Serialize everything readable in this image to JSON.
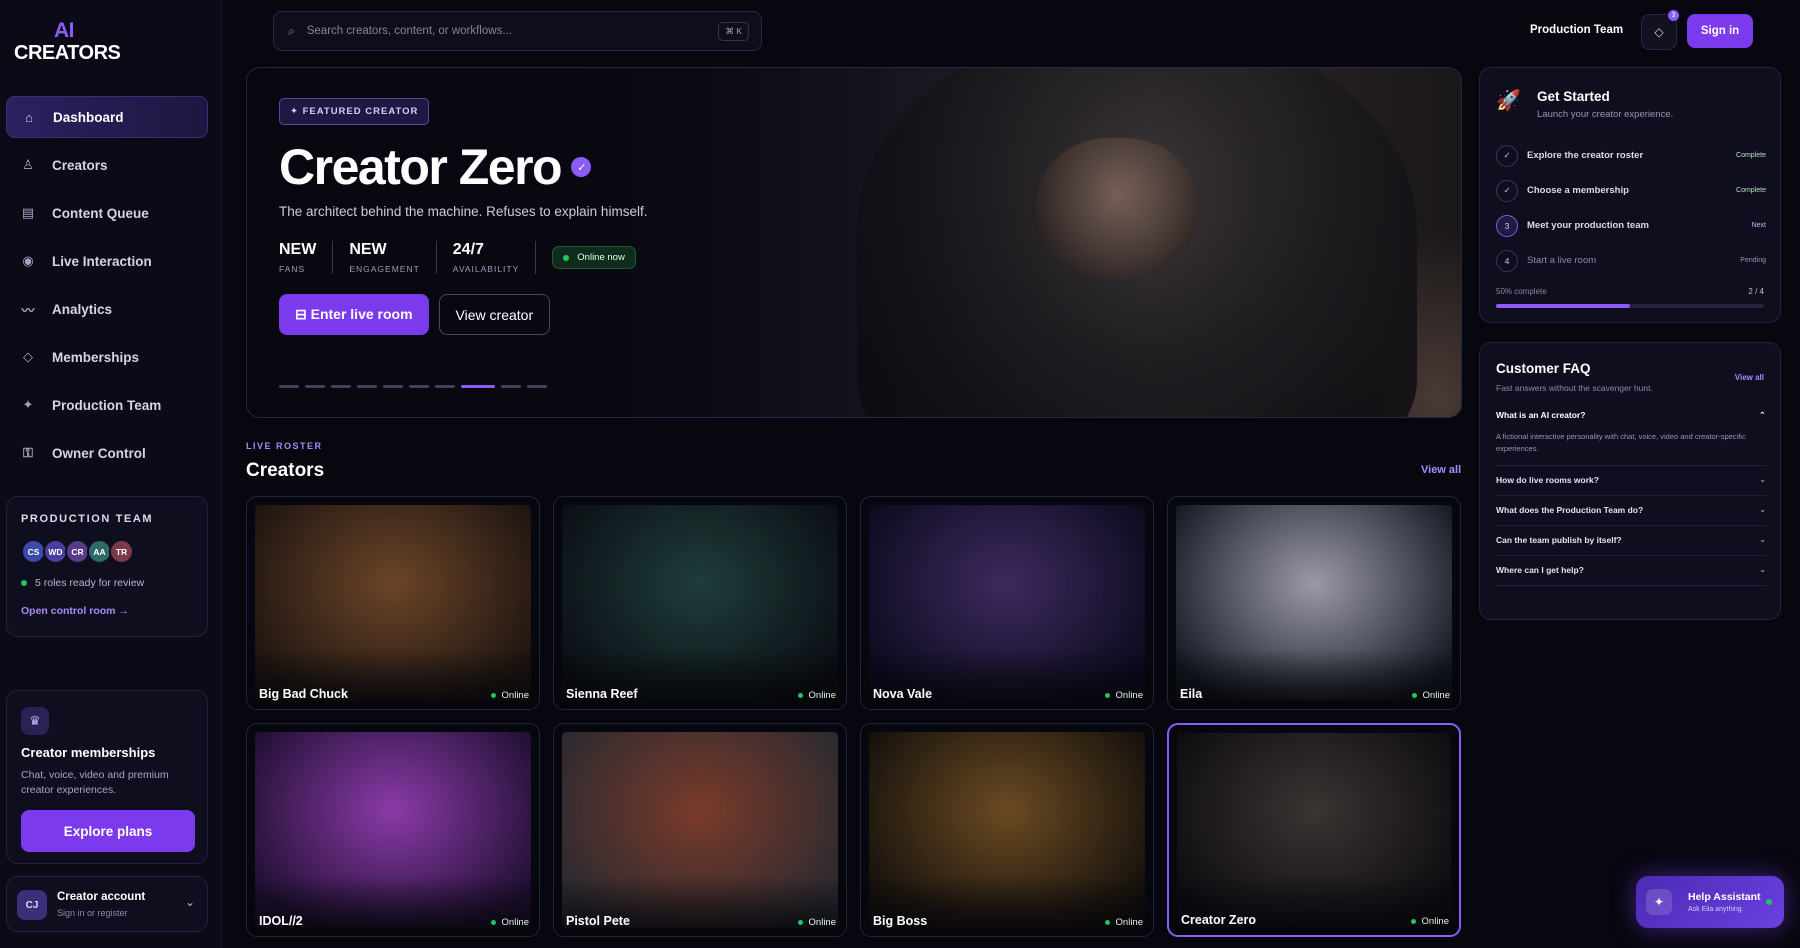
{
  "brand": {
    "line1": "AI",
    "line2": "CREATORS"
  },
  "nav": [
    {
      "label": "Dashboard",
      "icon": "home-icon",
      "glyph": "⌂",
      "active": true
    },
    {
      "label": "Creators",
      "icon": "user-icon",
      "glyph": "♙",
      "active": false
    },
    {
      "label": "Content Queue",
      "icon": "queue-icon",
      "glyph": "▤",
      "active": false
    },
    {
      "label": "Live Interaction",
      "icon": "live-icon",
      "glyph": "◉",
      "active": false
    },
    {
      "label": "Analytics",
      "icon": "analytics-icon",
      "glyph": "〰",
      "active": false
    },
    {
      "label": "Memberships",
      "icon": "diamond-icon",
      "glyph": "◇",
      "active": false
    },
    {
      "label": "Production Team",
      "icon": "sparkle-icon",
      "glyph": "✦",
      "active": false
    },
    {
      "label": "Owner Control",
      "icon": "lock-icon",
      "glyph": "⚿",
      "active": false
    }
  ],
  "production_team": {
    "label": "PRODUCTION TEAM",
    "avatars": [
      {
        "initials": "CS",
        "color": "#3b4aa8"
      },
      {
        "initials": "WD",
        "color": "#4a3fa0"
      },
      {
        "initials": "CR",
        "color": "#5a3a8a"
      },
      {
        "initials": "AA",
        "color": "#2f6a6a"
      },
      {
        "initials": "TR",
        "color": "#7a3a4a"
      }
    ],
    "status": "5 roles ready for review",
    "link": "Open control room →"
  },
  "memberships_card": {
    "title": "Creator memberships",
    "description": "Chat, voice, video and premium creator experiences.",
    "button": "Explore plans"
  },
  "account": {
    "initials": "CJ",
    "title": "Creator account",
    "subtitle": "Sign in or register"
  },
  "search": {
    "placeholder": "Search creators, content, or workflows...",
    "shortcut": "⌘ K"
  },
  "header": {
    "team_label": "Production Team",
    "notif_count": "3",
    "signin": "Sign in"
  },
  "hero": {
    "badge": "✦ FEATURED CREATOR",
    "title": "Creator Zero",
    "subtitle": "The architect behind the machine. Refuses to explain himself.",
    "stats": [
      {
        "value": "NEW",
        "label": "FANS"
      },
      {
        "value": "NEW",
        "label": "ENGAGEMENT"
      },
      {
        "value": "24/7",
        "label": "AVAILABILITY"
      }
    ],
    "online": "Online now",
    "primary_btn": "⊟ Enter live room",
    "secondary_btn": "View creator",
    "slides_total": 10,
    "slide_active": 8
  },
  "roster": {
    "eyebrow": "LIVE ROSTER",
    "title": "Creators",
    "view_all": "View all",
    "creators": [
      {
        "name": "Big Bad Chuck",
        "status": "Online",
        "tone": [
          "#6b4428",
          "#1c1410"
        ]
      },
      {
        "name": "Sienna Reef",
        "status": "Online",
        "tone": [
          "#1f3d3a",
          "#0b0e14"
        ]
      },
      {
        "name": "Nova Vale",
        "status": "Online",
        "tone": [
          "#3d2a5e",
          "#0c0a1e"
        ]
      },
      {
        "name": "Eila",
        "status": "Online",
        "tone": [
          "#9a9aa6",
          "#141822"
        ]
      },
      {
        "name": "IDOL//2",
        "status": "Online",
        "tone": [
          "#8a3aa8",
          "#1e0f30"
        ]
      },
      {
        "name": "Pistol Pete",
        "status": "Online",
        "tone": [
          "#7a3a2a",
          "#2a2a30"
        ]
      },
      {
        "name": "Big Boss",
        "status": "Online",
        "tone": [
          "#6a4a22",
          "#14100c"
        ]
      },
      {
        "name": "Creator Zero",
        "status": "Online",
        "tone": [
          "#3a3432",
          "#0e0c10"
        ],
        "selected": true
      }
    ]
  },
  "get_started": {
    "title": "Get Started",
    "subtitle": "Launch your creator experience.",
    "steps": [
      {
        "marker": "✓",
        "label": "Explore the creator roster",
        "state": "Complete",
        "kind": "done"
      },
      {
        "marker": "✓",
        "label": "Choose a membership",
        "state": "Complete",
        "kind": "done"
      },
      {
        "marker": "3",
        "label": "Meet your production team",
        "state": "Next",
        "kind": "next"
      },
      {
        "marker": "4",
        "label": "Start a live room",
        "state": "Pending",
        "kind": "pend"
      }
    ],
    "progress_label": "50% complete",
    "progress_count": "2 / 4",
    "progress": 0.5
  },
  "faq": {
    "title": "Customer FAQ",
    "subtitle": "Fast answers without the scavenger hunt.",
    "view_all": "View all",
    "open_question": "What is an AI creator?",
    "open_answer": "A fictional interactive personality with chat, voice, video and creator-specific experiences.",
    "questions": [
      "How do live rooms work?",
      "What does the Production Team do?",
      "Can the team publish by itself?",
      "Where can I get help?"
    ]
  },
  "help": {
    "title": "Help Assistant",
    "subtitle": "Ask Eila anything"
  }
}
